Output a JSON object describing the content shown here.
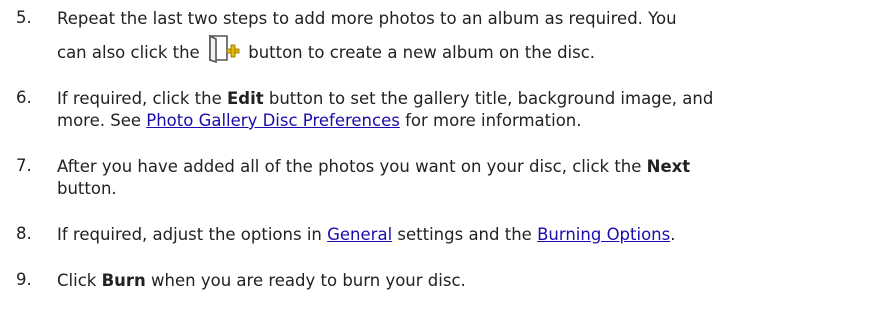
{
  "steps": [
    {
      "number": "5.",
      "line1": "Repeat the last two steps to add more photos to an album as required. You",
      "line2_before": "can also click the",
      "line2_icon": "add-album-icon",
      "line2_after": "button to create a new album on the disc."
    },
    {
      "number": "6.",
      "line1_before": "If required, click the",
      "line1_bold": "Edit",
      "line1_after": "button to set the gallery title, background image, and",
      "line2_before": "more. See",
      "line2_link": "Photo Gallery Disc Preferences",
      "line2_after": "for more information."
    },
    {
      "number": "7.",
      "line1_before": "After you have added all of the photos you want on your disc, click the",
      "line1_bold": "Next",
      "line2": "button."
    },
    {
      "number": "8.",
      "before": "If required, adjust the options in",
      "link1": "General",
      "middle": "settings and the",
      "link2": "Burning Options",
      "after": "."
    },
    {
      "number": "9.",
      "before": "Click",
      "bold": "Burn",
      "after": "when you are ready to burn your disc."
    }
  ]
}
